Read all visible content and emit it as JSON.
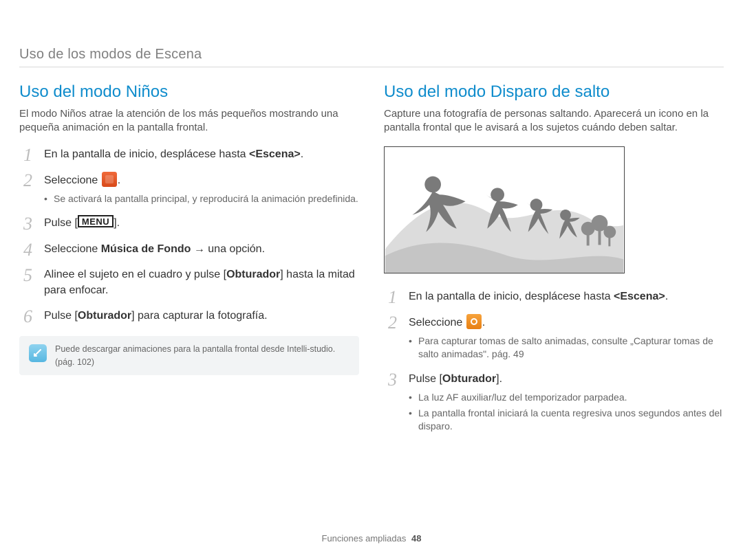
{
  "breadcrumb": "Uso de los modos de Escena",
  "footer": {
    "label": "Funciones ampliadas",
    "page": "48"
  },
  "menu_glyph": "MENU",
  "left": {
    "title": "Uso del modo Niños",
    "lead": "El modo Niños atrae la atención de los más pequeños mostrando una pequeña animación en la pantalla frontal.",
    "steps": [
      {
        "pre": "En la pantalla de inicio, desplácese hasta ",
        "bold": "<Escena>",
        "post": "."
      },
      {
        "pre": "Seleccione ",
        "icon": "red",
        "post": ".",
        "bullets": [
          "Se activará la pantalla principal, y reproducirá la animación predefinida."
        ]
      },
      {
        "pre": "Pulse [",
        "glyph": "menu",
        "post": "]."
      },
      {
        "pre": "Seleccione ",
        "bold": "Música de Fondo",
        "arrow": " → una opción."
      },
      {
        "pre": "Alinee el sujeto en el cuadro y pulse [",
        "bold": "Obturador",
        "post": "] hasta la mitad para enfocar."
      },
      {
        "pre": "Pulse [",
        "bold": "Obturador",
        "post": "] para capturar la fotografía."
      }
    ],
    "note": "Puede descargar animaciones para la pantalla frontal desde Intelli-studio. (pág. 102)"
  },
  "right": {
    "title": "Uso del modo Disparo de salto",
    "lead": "Capture una fotografía de personas saltando. Aparecerá un icono en la pantalla frontal que le avisará a los sujetos cuándo deben saltar.",
    "steps": [
      {
        "pre": "En la pantalla de inicio, desplácese hasta ",
        "bold": "<Escena>",
        "post": "."
      },
      {
        "pre": "Seleccione ",
        "icon": "orange",
        "post": ".",
        "bullets": [
          "Para capturar tomas de salto animadas, consulte „Capturar tomas de salto animadas\". pág. 49"
        ]
      },
      {
        "pre": "Pulse [",
        "bold": "Obturador",
        "post": "].",
        "bullets": [
          "La luz AF auxiliar/luz del temporizador parpadea.",
          "La pantalla frontal iniciará la cuenta regresiva unos segundos antes del disparo."
        ]
      }
    ]
  }
}
